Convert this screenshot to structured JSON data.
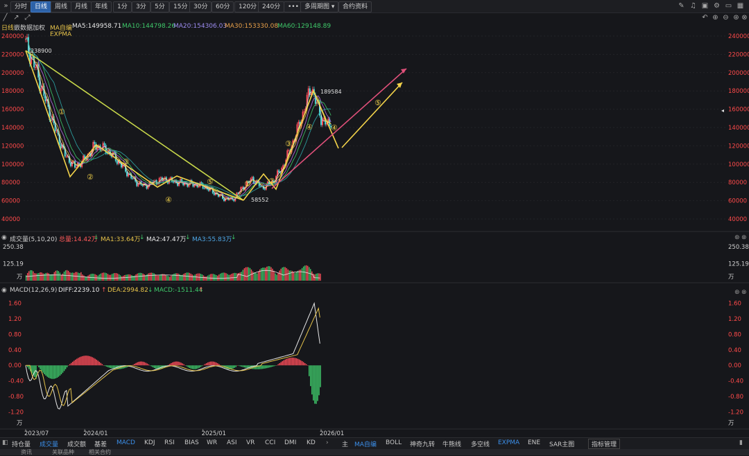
{
  "toolbar": {
    "periods": [
      "分时",
      "日线",
      "周线",
      "月线",
      "年线",
      "1分",
      "3分",
      "5分",
      "15分",
      "30分",
      "60分",
      "120分",
      "240分"
    ],
    "active_period": "日线",
    "more_label": "•••",
    "multi_period": "多周期图 ▾",
    "contract_info": "合约资料"
  },
  "ma_bar": {
    "period": "日线",
    "adjust": "嵌数据加权",
    "ma_self": "MA自编",
    "ma5": "MA5:149958.71",
    "ma10": "MA10:144798.26",
    "ma20": "MA20:154306.03",
    "ma30": "MA30:153330.08",
    "ma60": "MA60:129148.89",
    "expma": "EXPMA",
    "colors": {
      "ma5": "#e8e8e8",
      "ma10": "#e8c44a",
      "ma20": "#b86ee6",
      "ma30": "#3fc96a",
      "ma60": "#d9684b",
      "up": "#ff4040"
    }
  },
  "volume_bar": {
    "title": "成交量(5,10,20)",
    "total": "总量:14.42万",
    "ma1": "MA1:33.64万",
    "ma2": "MA2:47.47万",
    "ma3": "MA3:55.83万",
    "down_arrow": "↓"
  },
  "macd_bar": {
    "title": "MACD(12,26,9)",
    "diff": "DIFF:2239.10",
    "dea": "DEA:2994.82",
    "macd": "MACD:-1511.44"
  },
  "indicator_tabs": [
    "持仓量",
    "成交量",
    "成交额",
    "基差",
    "MACD",
    "KDJ",
    "RSI",
    "BIAS",
    "WR",
    "ASI",
    "VR",
    "CCI",
    "DMI",
    "KD"
  ],
  "indicator_selected": [
    "成交量",
    "MACD"
  ],
  "overlay_tabs": [
    "主",
    "MA自编",
    "BOLL",
    "神奇九转",
    "牛熊线",
    "多空线",
    "EXPMA",
    "ENE",
    "SAR主图",
    "指标管理"
  ],
  "overlay_selected": [
    "MA自编",
    "EXPMA"
  ],
  "bottom_tabs": [
    "资讯",
    "关联品种",
    "相关合约"
  ],
  "chart_data": [
    {
      "type": "candlestick",
      "x_labels": [
        "2023/07",
        "2024/01",
        "2025/01",
        "2026/01"
      ],
      "ylim": [
        40000,
        240000
      ],
      "y_ticks": [
        40000,
        60000,
        80000,
        100000,
        120000,
        140000,
        160000,
        180000,
        200000,
        220000,
        240000
      ],
      "annotations": {
        "high_start": "238900",
        "low": "58552",
        "high_end": "189584"
      },
      "wave_labels": [
        "①",
        "②",
        "③",
        "④",
        "⑤"
      ],
      "close_path": [
        [
          "2023/07",
          232000
        ],
        [
          "2023/08",
          205000
        ],
        [
          "2023/09",
          170000
        ],
        [
          "2023/10",
          138000
        ],
        [
          "2023/11",
          110000
        ],
        [
          "2023/12",
          97000
        ],
        [
          "2024/01",
          105000
        ],
        [
          "2024/02",
          120000
        ],
        [
          "2024/03",
          117000
        ],
        [
          "2024/04",
          108000
        ],
        [
          "2024/05",
          95000
        ],
        [
          "2024/06",
          82000
        ],
        [
          "2024/07",
          76000
        ],
        [
          "2024/08",
          80000
        ],
        [
          "2024/09",
          84000
        ],
        [
          "2024/10",
          81000
        ],
        [
          "2024/11",
          79000
        ],
        [
          "2024/12",
          78000
        ],
        [
          "2025/01",
          76000
        ],
        [
          "2025/02",
          70000
        ],
        [
          "2025/03",
          63000
        ],
        [
          "2025/04",
          61000
        ],
        [
          "2025/05",
          74000
        ],
        [
          "2025/06",
          84000
        ],
        [
          "2025/07",
          74000
        ],
        [
          "2025/08",
          80000
        ],
        [
          "2025/09",
          95000
        ],
        [
          "2025/10",
          120000
        ],
        [
          "2025/11",
          150000
        ],
        [
          "2025/12",
          185000
        ],
        [
          "2026/01",
          150000
        ],
        [
          "2026/02",
          140000
        ]
      ]
    },
    {
      "type": "bar",
      "name": "成交量",
      "ylim": [
        0,
        250.38
      ],
      "y_ticks": [
        "250.38",
        "125.19"
      ],
      "unit": "万"
    },
    {
      "type": "bar",
      "name": "MACD",
      "ylim": [
        -1.3,
        1.7
      ],
      "y_ticks": [
        "1.60",
        "1.20",
        "0.80",
        "0.40",
        "0.00",
        "-0.40",
        "-0.80",
        "-1.20"
      ],
      "unit": "万"
    }
  ]
}
